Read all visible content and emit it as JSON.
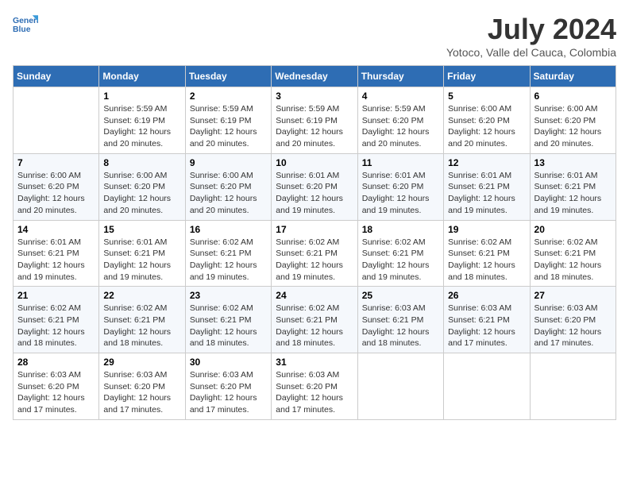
{
  "header": {
    "logo_line1": "General",
    "logo_line2": "Blue",
    "month_title": "July 2024",
    "subtitle": "Yotoco, Valle del Cauca, Colombia"
  },
  "days_of_week": [
    "Sunday",
    "Monday",
    "Tuesday",
    "Wednesday",
    "Thursday",
    "Friday",
    "Saturday"
  ],
  "weeks": [
    [
      {
        "day": "",
        "sunrise": "",
        "sunset": "",
        "daylight": ""
      },
      {
        "day": "1",
        "sunrise": "Sunrise: 5:59 AM",
        "sunset": "Sunset: 6:19 PM",
        "daylight": "Daylight: 12 hours and 20 minutes."
      },
      {
        "day": "2",
        "sunrise": "Sunrise: 5:59 AM",
        "sunset": "Sunset: 6:19 PM",
        "daylight": "Daylight: 12 hours and 20 minutes."
      },
      {
        "day": "3",
        "sunrise": "Sunrise: 5:59 AM",
        "sunset": "Sunset: 6:19 PM",
        "daylight": "Daylight: 12 hours and 20 minutes."
      },
      {
        "day": "4",
        "sunrise": "Sunrise: 5:59 AM",
        "sunset": "Sunset: 6:20 PM",
        "daylight": "Daylight: 12 hours and 20 minutes."
      },
      {
        "day": "5",
        "sunrise": "Sunrise: 6:00 AM",
        "sunset": "Sunset: 6:20 PM",
        "daylight": "Daylight: 12 hours and 20 minutes."
      },
      {
        "day": "6",
        "sunrise": "Sunrise: 6:00 AM",
        "sunset": "Sunset: 6:20 PM",
        "daylight": "Daylight: 12 hours and 20 minutes."
      }
    ],
    [
      {
        "day": "7",
        "sunrise": "Sunrise: 6:00 AM",
        "sunset": "Sunset: 6:20 PM",
        "daylight": "Daylight: 12 hours and 20 minutes."
      },
      {
        "day": "8",
        "sunrise": "Sunrise: 6:00 AM",
        "sunset": "Sunset: 6:20 PM",
        "daylight": "Daylight: 12 hours and 20 minutes."
      },
      {
        "day": "9",
        "sunrise": "Sunrise: 6:00 AM",
        "sunset": "Sunset: 6:20 PM",
        "daylight": "Daylight: 12 hours and 20 minutes."
      },
      {
        "day": "10",
        "sunrise": "Sunrise: 6:01 AM",
        "sunset": "Sunset: 6:20 PM",
        "daylight": "Daylight: 12 hours and 19 minutes."
      },
      {
        "day": "11",
        "sunrise": "Sunrise: 6:01 AM",
        "sunset": "Sunset: 6:20 PM",
        "daylight": "Daylight: 12 hours and 19 minutes."
      },
      {
        "day": "12",
        "sunrise": "Sunrise: 6:01 AM",
        "sunset": "Sunset: 6:21 PM",
        "daylight": "Daylight: 12 hours and 19 minutes."
      },
      {
        "day": "13",
        "sunrise": "Sunrise: 6:01 AM",
        "sunset": "Sunset: 6:21 PM",
        "daylight": "Daylight: 12 hours and 19 minutes."
      }
    ],
    [
      {
        "day": "14",
        "sunrise": "Sunrise: 6:01 AM",
        "sunset": "Sunset: 6:21 PM",
        "daylight": "Daylight: 12 hours and 19 minutes."
      },
      {
        "day": "15",
        "sunrise": "Sunrise: 6:01 AM",
        "sunset": "Sunset: 6:21 PM",
        "daylight": "Daylight: 12 hours and 19 minutes."
      },
      {
        "day": "16",
        "sunrise": "Sunrise: 6:02 AM",
        "sunset": "Sunset: 6:21 PM",
        "daylight": "Daylight: 12 hours and 19 minutes."
      },
      {
        "day": "17",
        "sunrise": "Sunrise: 6:02 AM",
        "sunset": "Sunset: 6:21 PM",
        "daylight": "Daylight: 12 hours and 19 minutes."
      },
      {
        "day": "18",
        "sunrise": "Sunrise: 6:02 AM",
        "sunset": "Sunset: 6:21 PM",
        "daylight": "Daylight: 12 hours and 19 minutes."
      },
      {
        "day": "19",
        "sunrise": "Sunrise: 6:02 AM",
        "sunset": "Sunset: 6:21 PM",
        "daylight": "Daylight: 12 hours and 18 minutes."
      },
      {
        "day": "20",
        "sunrise": "Sunrise: 6:02 AM",
        "sunset": "Sunset: 6:21 PM",
        "daylight": "Daylight: 12 hours and 18 minutes."
      }
    ],
    [
      {
        "day": "21",
        "sunrise": "Sunrise: 6:02 AM",
        "sunset": "Sunset: 6:21 PM",
        "daylight": "Daylight: 12 hours and 18 minutes."
      },
      {
        "day": "22",
        "sunrise": "Sunrise: 6:02 AM",
        "sunset": "Sunset: 6:21 PM",
        "daylight": "Daylight: 12 hours and 18 minutes."
      },
      {
        "day": "23",
        "sunrise": "Sunrise: 6:02 AM",
        "sunset": "Sunset: 6:21 PM",
        "daylight": "Daylight: 12 hours and 18 minutes."
      },
      {
        "day": "24",
        "sunrise": "Sunrise: 6:02 AM",
        "sunset": "Sunset: 6:21 PM",
        "daylight": "Daylight: 12 hours and 18 minutes."
      },
      {
        "day": "25",
        "sunrise": "Sunrise: 6:03 AM",
        "sunset": "Sunset: 6:21 PM",
        "daylight": "Daylight: 12 hours and 18 minutes."
      },
      {
        "day": "26",
        "sunrise": "Sunrise: 6:03 AM",
        "sunset": "Sunset: 6:21 PM",
        "daylight": "Daylight: 12 hours and 17 minutes."
      },
      {
        "day": "27",
        "sunrise": "Sunrise: 6:03 AM",
        "sunset": "Sunset: 6:20 PM",
        "daylight": "Daylight: 12 hours and 17 minutes."
      }
    ],
    [
      {
        "day": "28",
        "sunrise": "Sunrise: 6:03 AM",
        "sunset": "Sunset: 6:20 PM",
        "daylight": "Daylight: 12 hours and 17 minutes."
      },
      {
        "day": "29",
        "sunrise": "Sunrise: 6:03 AM",
        "sunset": "Sunset: 6:20 PM",
        "daylight": "Daylight: 12 hours and 17 minutes."
      },
      {
        "day": "30",
        "sunrise": "Sunrise: 6:03 AM",
        "sunset": "Sunset: 6:20 PM",
        "daylight": "Daylight: 12 hours and 17 minutes."
      },
      {
        "day": "31",
        "sunrise": "Sunrise: 6:03 AM",
        "sunset": "Sunset: 6:20 PM",
        "daylight": "Daylight: 12 hours and 17 minutes."
      },
      {
        "day": "",
        "sunrise": "",
        "sunset": "",
        "daylight": ""
      },
      {
        "day": "",
        "sunrise": "",
        "sunset": "",
        "daylight": ""
      },
      {
        "day": "",
        "sunrise": "",
        "sunset": "",
        "daylight": ""
      }
    ]
  ]
}
